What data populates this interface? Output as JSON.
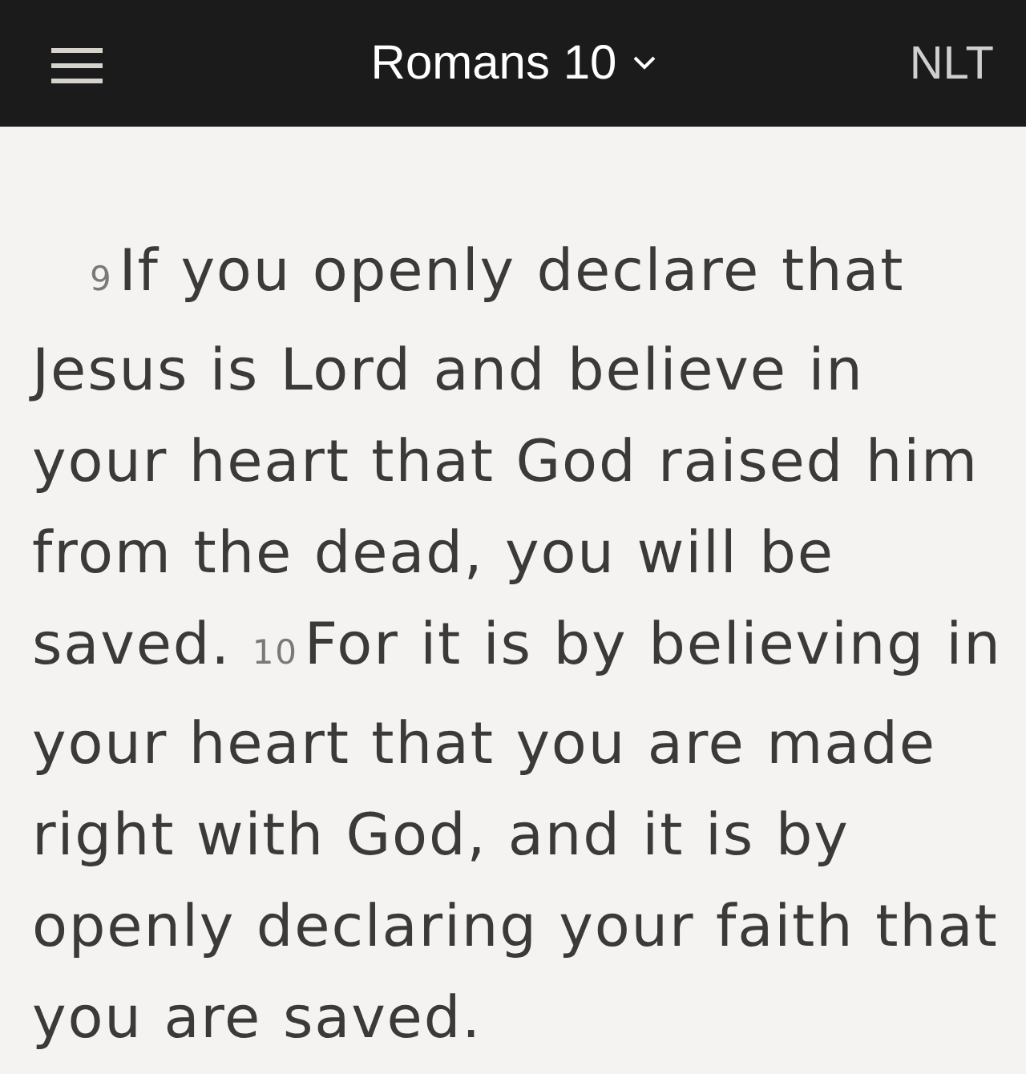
{
  "header": {
    "title": "Romans 10",
    "version": "NLT"
  },
  "verses": [
    {
      "number": "9",
      "text": "If you openly declare that Jesus is Lord and believe in your heart that God raised him from the dead, you will be saved."
    },
    {
      "number": "10",
      "text": "For it is by believing in your heart that you are made right with God, and it is by openly declaring your faith that you are saved."
    }
  ]
}
